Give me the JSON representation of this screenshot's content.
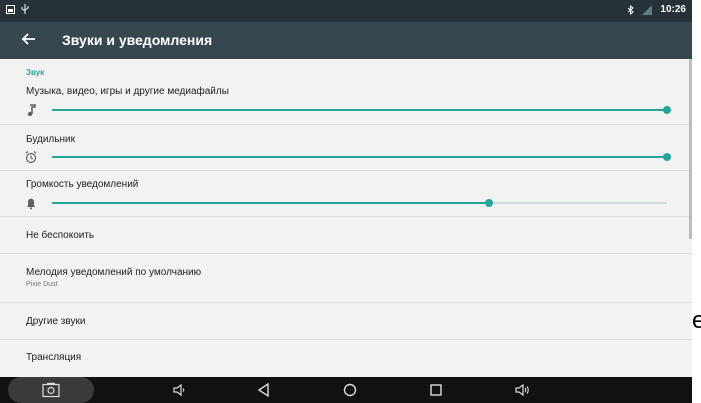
{
  "status_bar": {
    "time": "10:26",
    "left_icons": [
      "screenshot-icon",
      "usb-icon"
    ],
    "right_icons": [
      "bluetooth-icon",
      "signal-icon"
    ]
  },
  "toolbar": {
    "title": "Звуки и уведомления",
    "back_icon": "arrow-back-icon"
  },
  "section_header": "Звук",
  "volumes": [
    {
      "label": "Музыка, видео, игры и другие медиафайлы",
      "icon": "music-note-icon",
      "level": 1.0
    },
    {
      "label": "Будильник",
      "icon": "alarm-icon",
      "level": 1.0
    },
    {
      "label": "Громкость уведомлений",
      "icon": "bell-icon",
      "level": 0.71
    }
  ],
  "rows": {
    "do_not_disturb": "Не беспокоить",
    "default_ringtone": "Мелодия уведомлений по умолчанию",
    "default_ringtone_value": "Pixie Dust",
    "other_sounds": "Другие звуки",
    "cast": "Трансляция"
  },
  "navbar": {
    "icons": [
      "screenshot-icon",
      "volume-down-icon",
      "back-icon",
      "home-icon",
      "recents-icon",
      "volume-up-icon"
    ]
  },
  "stray_text": "e",
  "colors": {
    "accent": "#26a69a",
    "toolbar": "#37474f",
    "status_bar": "#263238",
    "nav_bar": "#111111"
  }
}
